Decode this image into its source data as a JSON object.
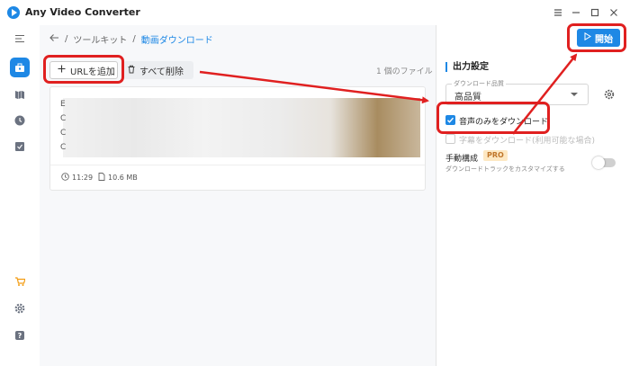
{
  "app": {
    "title": "Any Video Converter"
  },
  "breadcrumb": {
    "root": "ツールキット",
    "current": "動画ダウンロード"
  },
  "toolbar": {
    "add_url_label": "URLを追加",
    "delete_all_label": "すべて削除",
    "file_count": "1 個のファイル",
    "start_label": "開始"
  },
  "file": {
    "duration": "11:29",
    "size": "10.6 MB",
    "blurred_letters": [
      "E",
      "C",
      "C",
      "C"
    ]
  },
  "output": {
    "title": "出力設定",
    "quality_label": "ダウンロード品質",
    "quality_value": "高品質",
    "audio_only_label": "音声のみをダウンロード",
    "audio_only_checked": true,
    "subtitle_label": "字幕をダウンロード(利用可能な場合)",
    "subtitle_checked": false,
    "manual_title": "手動構成",
    "manual_badge": "PRO",
    "manual_desc": "ダウンロードトラックをカスタマイズする",
    "manual_enabled": false
  },
  "sidebar": {
    "items": [
      "menu-icon",
      "toolkit-icon",
      "library-icon",
      "history-icon",
      "tasks-icon",
      "cart-icon",
      "settings-icon",
      "help-icon"
    ]
  },
  "colors": {
    "accent": "#1e88e5",
    "annotation": "#e02020",
    "pro_bg": "#fde8c3",
    "pro_text": "#c0762a"
  }
}
